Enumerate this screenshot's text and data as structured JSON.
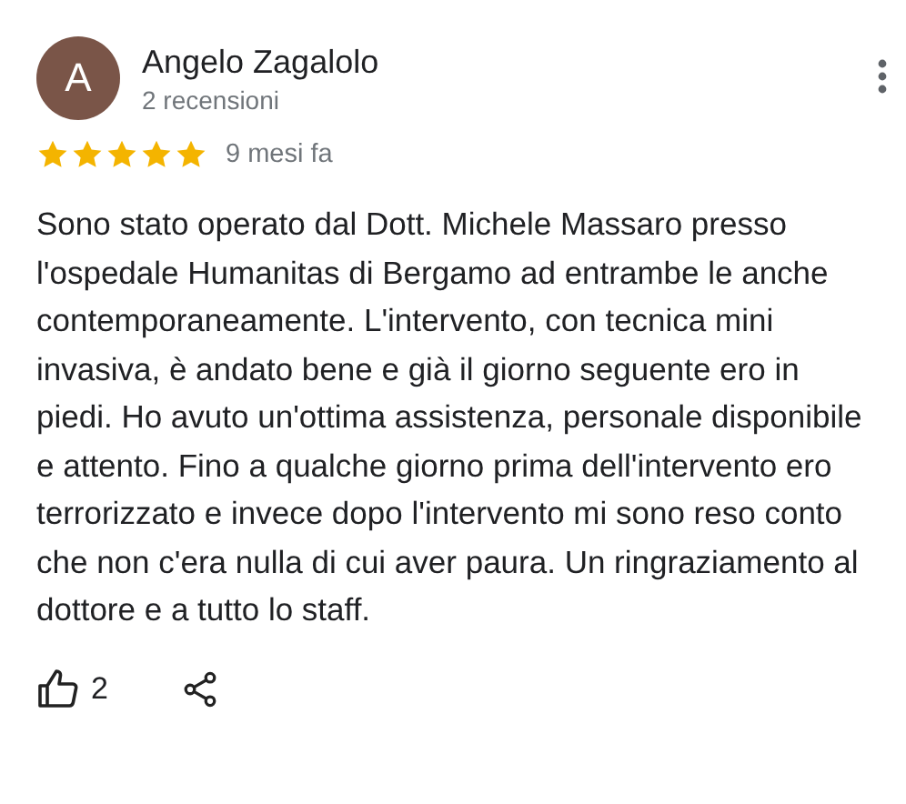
{
  "review": {
    "author": {
      "initial": "A",
      "name": "Angelo Zagalolo",
      "subtitle": "2 recensioni"
    },
    "stars": 5,
    "time": "9 mesi fa",
    "text": "Sono stato operato dal Dott. Michele Massaro presso l'ospedale Humanitas di Bergamo ad entrambe le anche contemporaneamente. L'intervento, con tecnica mini invasiva, è andato bene e già il giorno seguente ero in piedi. Ho avuto un'ottima assistenza, personale disponibile e attento. Fino a qualche giorno prima dell'intervento ero terrorizzato e invece dopo l'intervento mi sono reso conto che non c'era nulla di cui aver paura. Un ringraziamento al dottore e a tutto lo staff.",
    "likes": "2"
  }
}
